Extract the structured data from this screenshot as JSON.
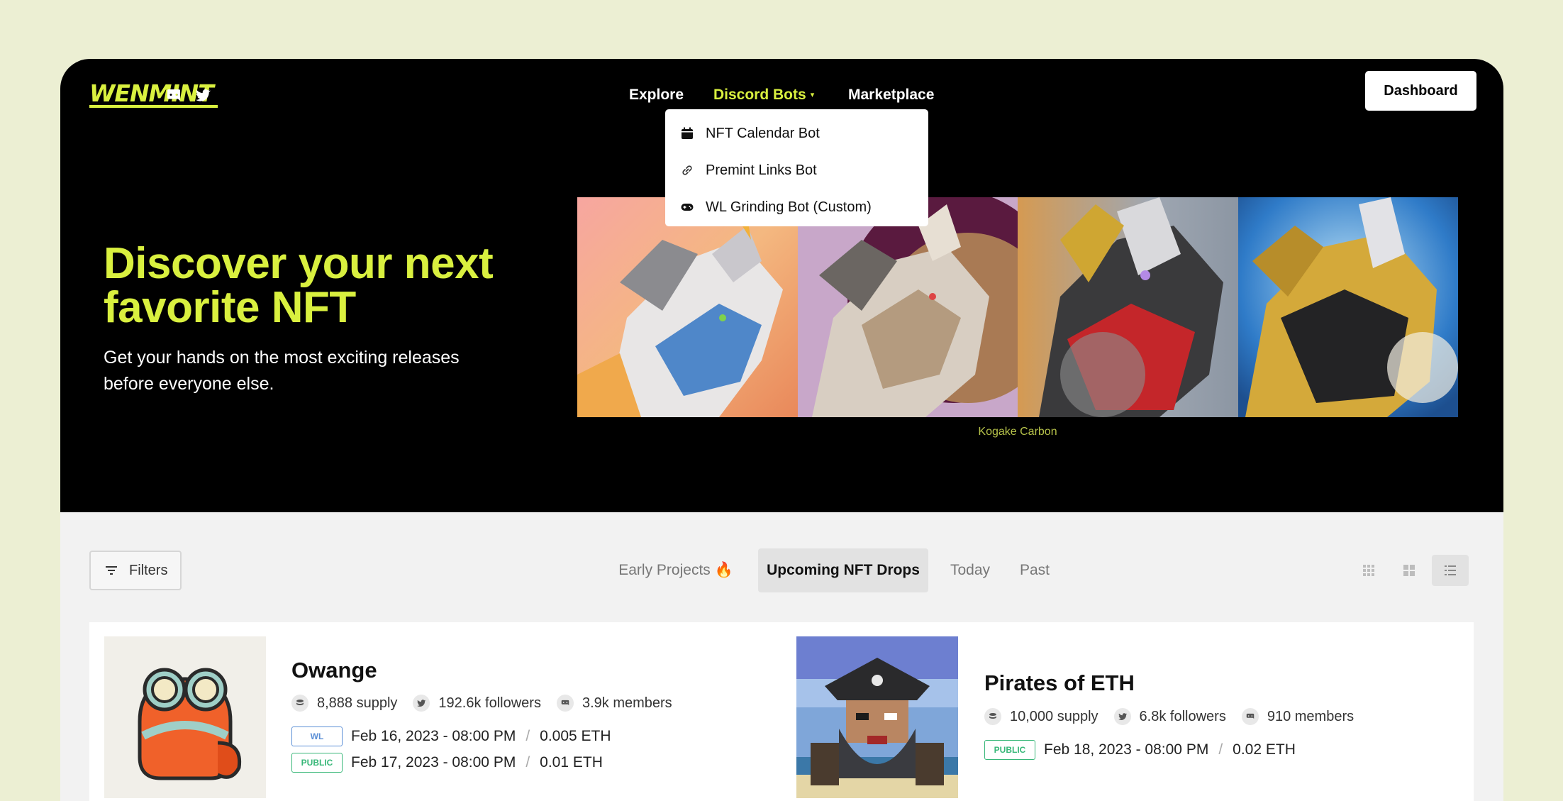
{
  "nav": {
    "logo": "WENMINT",
    "links": [
      {
        "label": "Explore"
      },
      {
        "label": "Discord Bots"
      },
      {
        "label": "Marketplace"
      }
    ],
    "dashboard_label": "Dashboard",
    "social_icons": [
      "discord-icon",
      "twitter-icon"
    ]
  },
  "dropdown": {
    "items": [
      {
        "label": "NFT Calendar Bot",
        "icon": "calendar-icon"
      },
      {
        "label": "Premint Links Bot",
        "icon": "link-icon"
      },
      {
        "label": "WL Grinding Bot (Custom)",
        "icon": "gamepad-icon"
      }
    ]
  },
  "hero": {
    "title": "Discover your next favorite NFT",
    "subtitle": "Get your hands on the most exciting releases before everyone else.",
    "banner_caption": "Kogake Carbon"
  },
  "toolbar": {
    "filters_label": "Filters",
    "tabs": [
      {
        "label": "Early Projects 🔥"
      },
      {
        "label": "Upcoming NFT Drops"
      },
      {
        "label": "Today"
      },
      {
        "label": "Past"
      }
    ],
    "active_tab": "Upcoming NFT Drops"
  },
  "projects": [
    {
      "name": "Owange",
      "supply": "8,888 supply",
      "followers": "192.6k followers",
      "members": "3.9k members",
      "phases": [
        {
          "badge": "WL",
          "date": "Feb 16, 2023 - 08:00 PM",
          "price": "0.005 ETH"
        },
        {
          "badge": "PUBLIC",
          "date": "Feb 17, 2023 - 08:00 PM",
          "price": "0.01 ETH"
        }
      ]
    },
    {
      "name": "Pirates of ETH",
      "supply": "10,000 supply",
      "followers": "6.8k followers",
      "members": "910 members",
      "phases": [
        {
          "badge": "PUBLIC",
          "date": "Feb 18, 2023 - 08:00 PM",
          "price": "0.02 ETH"
        }
      ]
    }
  ],
  "colors": {
    "accent": "#d9f03f",
    "page_bg": "#ecefd3",
    "hero_bg": "#000000",
    "wl_badge": "#5b8fd6",
    "public_badge": "#37b778"
  }
}
